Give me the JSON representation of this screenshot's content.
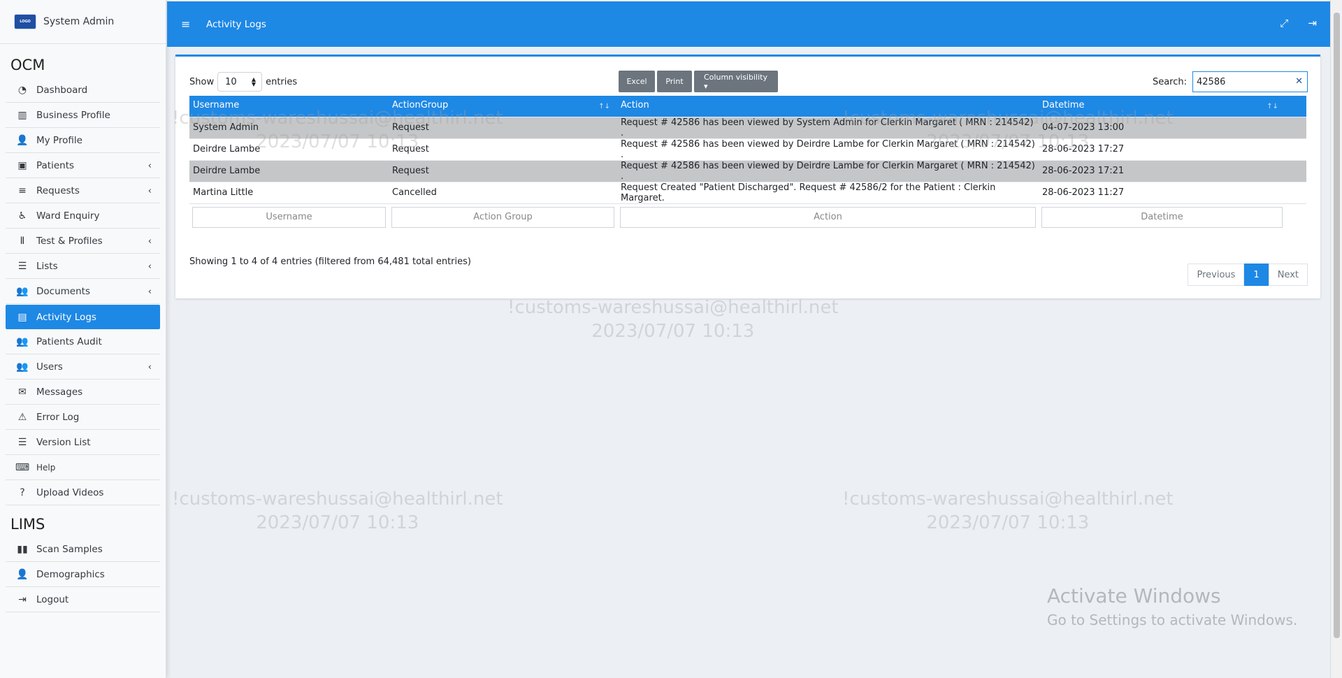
{
  "brand": {
    "name": "System Admin"
  },
  "sidebar": {
    "section_ocm": "OCM",
    "items": [
      {
        "label": "Dashboard",
        "icon": "gauge-icon",
        "glyph": "◔",
        "chevron": false
      },
      {
        "label": "Business Profile",
        "icon": "building-icon",
        "glyph": "▥",
        "chevron": false
      },
      {
        "label": "My Profile",
        "icon": "user-icon",
        "glyph": "👤",
        "chevron": false
      },
      {
        "label": "Patients",
        "icon": "id-card-icon",
        "glyph": "▣",
        "chevron": true
      },
      {
        "label": "Requests",
        "icon": "database-icon",
        "glyph": "≡",
        "chevron": true
      },
      {
        "label": "Ward Enquiry",
        "icon": "wheelchair-icon",
        "glyph": "♿",
        "chevron": false
      },
      {
        "label": "Test & Profiles",
        "icon": "vials-icon",
        "glyph": "Ⅱ",
        "chevron": true
      },
      {
        "label": "Lists",
        "icon": "list-icon",
        "glyph": "☰",
        "chevron": true
      },
      {
        "label": "Documents",
        "icon": "users-icon",
        "glyph": "👥",
        "chevron": true
      },
      {
        "label": "Activity Logs",
        "icon": "warehouse-icon",
        "glyph": "▤",
        "chevron": false,
        "active": true
      },
      {
        "label": "Patients Audit",
        "icon": "users-icon",
        "glyph": "👥",
        "chevron": false
      },
      {
        "label": "Users",
        "icon": "users-icon",
        "glyph": "👥",
        "chevron": true
      },
      {
        "label": "Messages",
        "icon": "envelope-icon",
        "glyph": "✉",
        "chevron": false
      },
      {
        "label": "Error Log",
        "icon": "warning-icon",
        "glyph": "⚠",
        "chevron": false
      },
      {
        "label": "Version List",
        "icon": "list-icon",
        "glyph": "☰",
        "chevron": false
      },
      {
        "label": "Help",
        "icon": "keyboard-icon",
        "glyph": "⌨",
        "chevron": false,
        "small": true
      },
      {
        "label": "Upload Videos",
        "icon": "question-icon",
        "glyph": "?",
        "chevron": false
      }
    ],
    "section_lims": "LIMS",
    "lims_items": [
      {
        "label": "Scan Samples",
        "icon": "barcode-icon",
        "glyph": "▮▮"
      },
      {
        "label": "Demographics",
        "icon": "user-doctor-icon",
        "glyph": "👤"
      },
      {
        "label": "Logout",
        "icon": "sign-out-icon",
        "glyph": "⇥"
      }
    ]
  },
  "header": {
    "title": "Activity Logs",
    "menu_glyph": "≡",
    "fullscreen_glyph": "⤢",
    "logout_glyph": "⇥"
  },
  "toolbar": {
    "show_label": "Show",
    "entries_value": "10",
    "entries_label": "entries",
    "excel": "Excel",
    "print": "Print",
    "column_visibility": "Column visibility ▾",
    "search_label": "Search:",
    "search_value": "42586",
    "clear_glyph": "✕"
  },
  "table": {
    "columns": [
      "Username",
      "ActionGroup",
      "Action",
      "Datetime"
    ],
    "rows": [
      [
        "System Admin",
        "Request",
        "Request # 42586 has been viewed by System Admin for Clerkin Margaret ( MRN : 214542) .",
        "04-07-2023 13:00"
      ],
      [
        "Deirdre Lambe",
        "Request",
        "Request # 42586 has been viewed by Deirdre Lambe for Clerkin Margaret ( MRN : 214542) .",
        "28-06-2023 17:27"
      ],
      [
        "Deirdre Lambe",
        "Request",
        "Request # 42586 has been viewed by Deirdre Lambe for Clerkin Margaret ( MRN : 214542) .",
        "28-06-2023 17:21"
      ],
      [
        "Martina Little",
        "Cancelled",
        "Request Created \"Patient Discharged\". Request # 42586/2 for the Patient : Clerkin Margaret.",
        "28-06-2023 11:27"
      ]
    ],
    "filters": [
      "Username",
      "Action Group",
      "Action",
      "Datetime"
    ]
  },
  "info": "Showing 1 to 4 of 4 entries (filtered from 64,481 total entries)",
  "pagination": {
    "previous": "Previous",
    "page": "1",
    "next": "Next"
  },
  "watermark": {
    "line1": "!customs-wareshussai@healthirl.net",
    "line2": "2023/07/07 10:13"
  },
  "activate_windows": {
    "title": "Activate Windows",
    "subtitle": "Go to Settings to activate Windows."
  }
}
